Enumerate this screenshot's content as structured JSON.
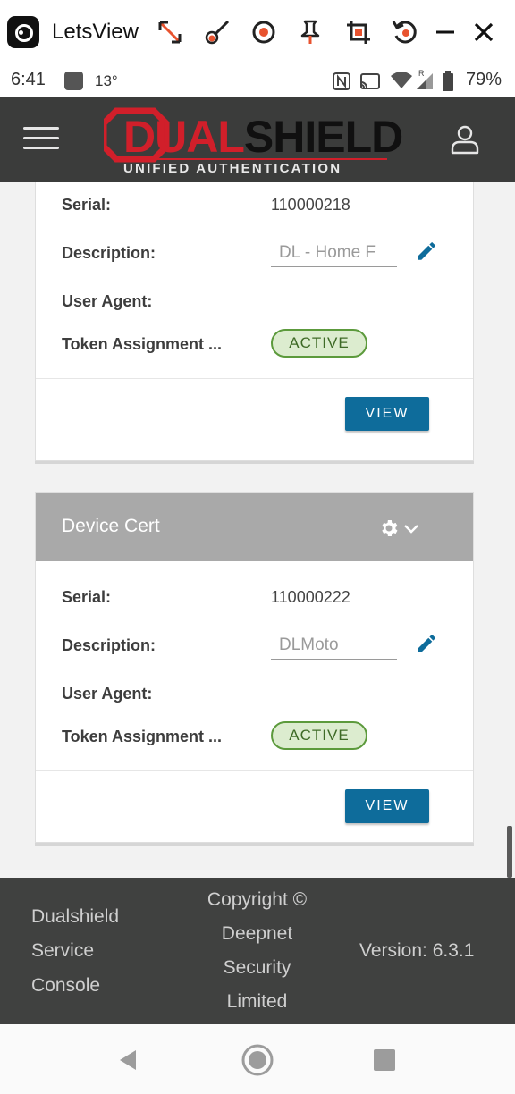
{
  "window": {
    "app_name": "LetsView",
    "tools": [
      "resize-icon",
      "draw-icon",
      "record-icon",
      "pin-icon",
      "crop-icon",
      "rotate-icon",
      "minimize-icon",
      "close-icon"
    ]
  },
  "status_bar": {
    "time": "6:41",
    "temperature": "13°",
    "battery": "79%"
  },
  "header": {
    "logo_dual": "DUAL",
    "logo_shield": "SHIELD",
    "logo_tagline": "UNIFIED AUTHENTICATION",
    "colors": {
      "background": "#3b3c3b",
      "brand_red": "#d11f2a"
    }
  },
  "labels": {
    "serial": "Serial:",
    "description": "Description:",
    "user_agent": "User Agent:",
    "token_assignment": "Token Assignment ..."
  },
  "cards": [
    {
      "serial": "110000218",
      "description": "DL - Home F",
      "user_agent": "",
      "status": "ACTIVE",
      "view_label": "VIEW"
    },
    {
      "title": "Device Cert",
      "serial": "110000222",
      "description": "DLMoto",
      "user_agent": "",
      "status": "ACTIVE",
      "view_label": "VIEW"
    }
  ],
  "footer": {
    "app_lines": [
      "Dualshield",
      "Service",
      "Console"
    ],
    "copyright_lines": [
      "Copyright ©",
      "Deepnet",
      "Security",
      "Limited"
    ],
    "version": "Version: 6.3.1"
  },
  "colors": {
    "view_button": "#0e6c9b",
    "badge_border": "#5c9a3c",
    "badge_fill": "#dceccf",
    "card_header": "#a9a9a9"
  }
}
